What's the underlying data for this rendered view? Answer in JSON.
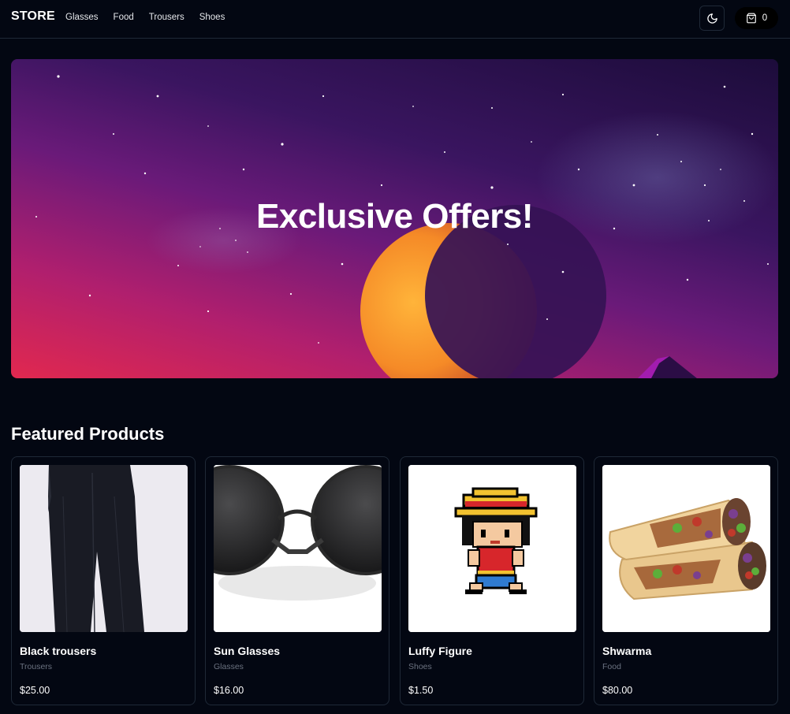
{
  "header": {
    "logo": "STORE",
    "nav": [
      "Glasses",
      "Food",
      "Trousers",
      "Shoes"
    ],
    "theme_icon": "moon-icon",
    "cart_icon": "shopping-bag-icon",
    "cart_count": "0"
  },
  "hero": {
    "title": "Exclusive Offers!"
  },
  "featured": {
    "title": "Featured Products",
    "products": [
      {
        "name": "Black trousers",
        "category": "Trousers",
        "price": "$25.00",
        "image": "black-trousers-image"
      },
      {
        "name": "Sun Glasses",
        "category": "Glasses",
        "price": "$16.00",
        "image": "sunglasses-image"
      },
      {
        "name": "Luffy Figure",
        "category": "Shoes",
        "price": "$1.50",
        "image": "pixel-luffy-image"
      },
      {
        "name": "Shwarma",
        "category": "Food",
        "price": "$80.00",
        "image": "shawarma-image"
      }
    ]
  },
  "colors": {
    "background": "#030712",
    "border": "#1f2937",
    "muted_text": "#6b7280"
  }
}
